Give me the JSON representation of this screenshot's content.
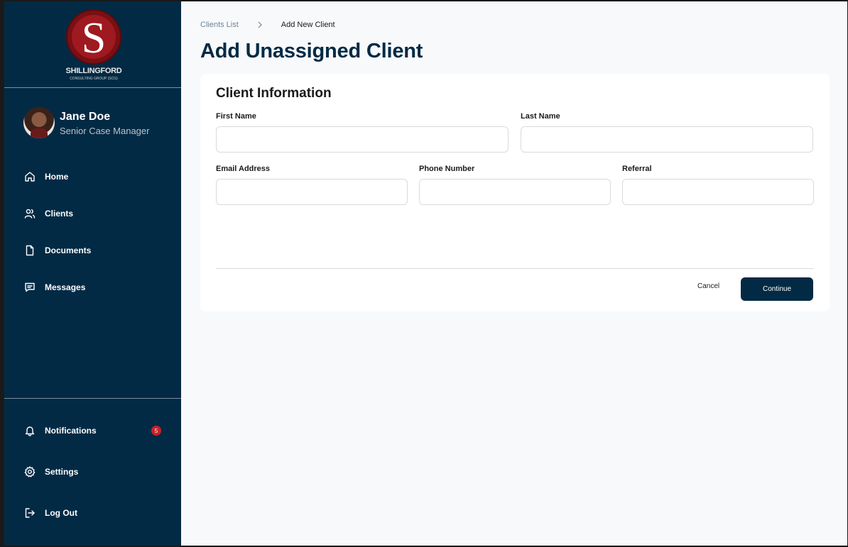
{
  "brand": {
    "logo_letter": "S",
    "logo_name": "SHILLINGFORD",
    "logo_sub": "CONSULTING GROUP (SCG)",
    "primary_color": "#032a44",
    "accent_color": "#c9212b"
  },
  "profile": {
    "name": "Jane Doe",
    "role": "Senior Case Manager"
  },
  "nav": {
    "home": "Home",
    "clients": "Clients",
    "documents": "Documents",
    "messages": "Messages",
    "notifications": "Notifications",
    "notifications_count": "5",
    "settings": "Settings",
    "logout": "Log Out"
  },
  "breadcrumb": {
    "parent": "Clients List",
    "current": "Add New Client"
  },
  "page": {
    "title": "Add Unassigned Client"
  },
  "form": {
    "section_title": "Client Information",
    "first_name_label": "First Name",
    "first_name_value": "",
    "last_name_label": "Last Name",
    "last_name_value": "",
    "email_label": "Email Address",
    "email_value": "",
    "phone_label": "Phone Number",
    "phone_value": "",
    "referral_label": "Referral",
    "referral_value": "",
    "cancel_label": "Cancel",
    "continue_label": "Continue"
  }
}
